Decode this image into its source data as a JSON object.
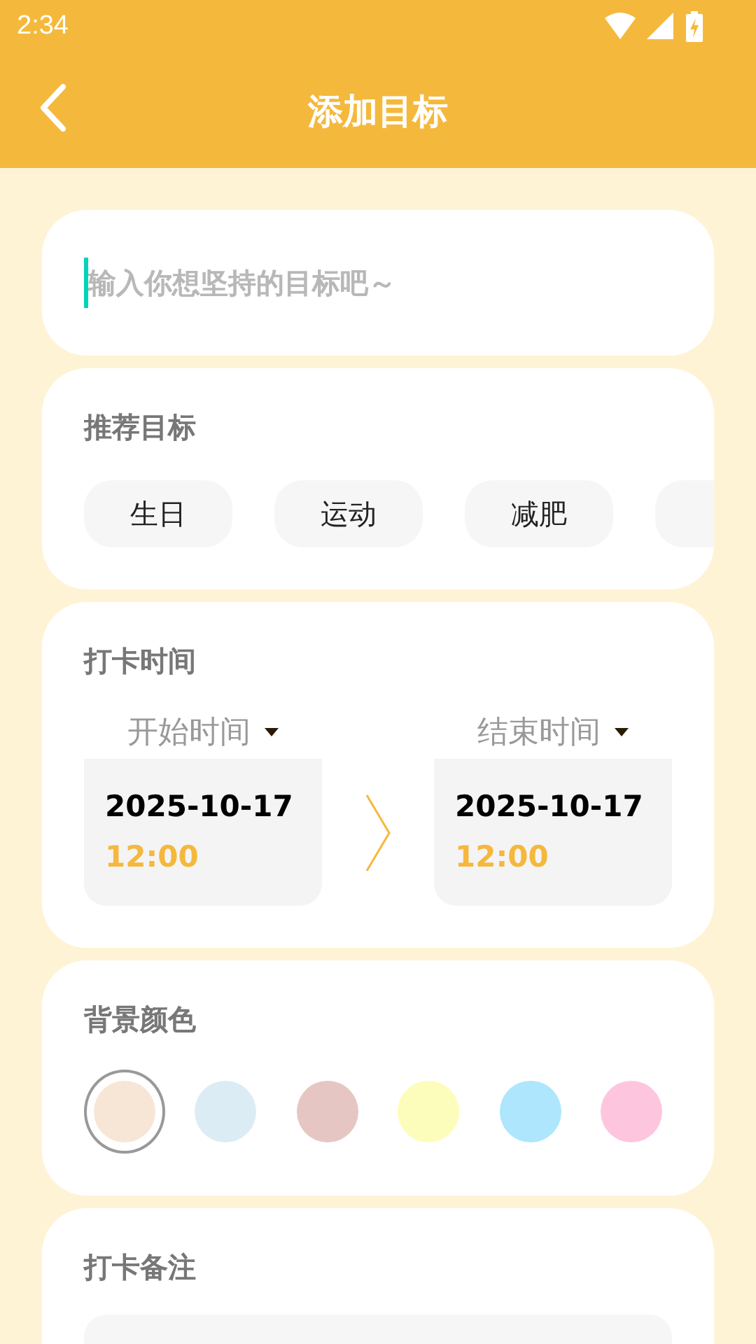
{
  "status_bar": {
    "time": "2:34"
  },
  "header": {
    "title": "添加目标"
  },
  "goal_input": {
    "placeholder": "输入你想坚持的目标吧～"
  },
  "recommended": {
    "title": "推荐目标",
    "chips": [
      {
        "label": "生日"
      },
      {
        "label": "运动"
      },
      {
        "label": "减肥"
      }
    ]
  },
  "checkin_time": {
    "title": "打卡时间",
    "start": {
      "label": "开始时间",
      "date": "2025-10-17",
      "time": "12:00"
    },
    "end": {
      "label": "结束时间",
      "date": "2025-10-17",
      "time": "12:00"
    }
  },
  "background_color": {
    "title": "背景颜色",
    "swatches": [
      {
        "color": "#f7e6d6",
        "selected": true
      },
      {
        "color": "#dcecf5",
        "selected": false
      },
      {
        "color": "#e6c6c3",
        "selected": false
      },
      {
        "color": "#fdfdbb",
        "selected": false
      },
      {
        "color": "#ade6fd",
        "selected": false
      },
      {
        "color": "#fec6de",
        "selected": false
      }
    ]
  },
  "notes": {
    "title": "打卡备注"
  }
}
